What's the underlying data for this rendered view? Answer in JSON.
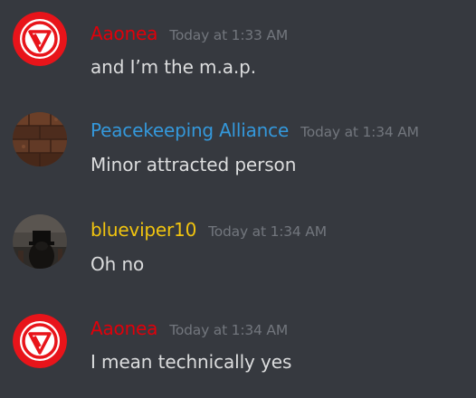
{
  "colors": {
    "background": "#36393f",
    "timestamp": "#72767d",
    "message_text": "#dcddde",
    "aaonea": "#e0000a",
    "peacekeeping": "#3498db",
    "blueviper": "#f1c40f"
  },
  "messages": [
    {
      "username": "Aaonea",
      "timestamp": "Today at 1:33 AM",
      "text": "and I’m the m.a.p.",
      "avatar_icon": "red-v-logo-icon"
    },
    {
      "username": "Peacekeeping Alliance",
      "timestamp": "Today at 1:34 AM",
      "text": "Minor attracted person",
      "avatar_icon": "brick-avatar-icon"
    },
    {
      "username": "blueviper10",
      "timestamp": "Today at 1:34 AM",
      "text": "Oh no",
      "avatar_icon": "dark-photo-avatar-icon"
    },
    {
      "username": "Aaonea",
      "timestamp": "Today at 1:34 AM",
      "text": "I mean technically yes",
      "avatar_icon": "red-v-logo-icon"
    }
  ]
}
